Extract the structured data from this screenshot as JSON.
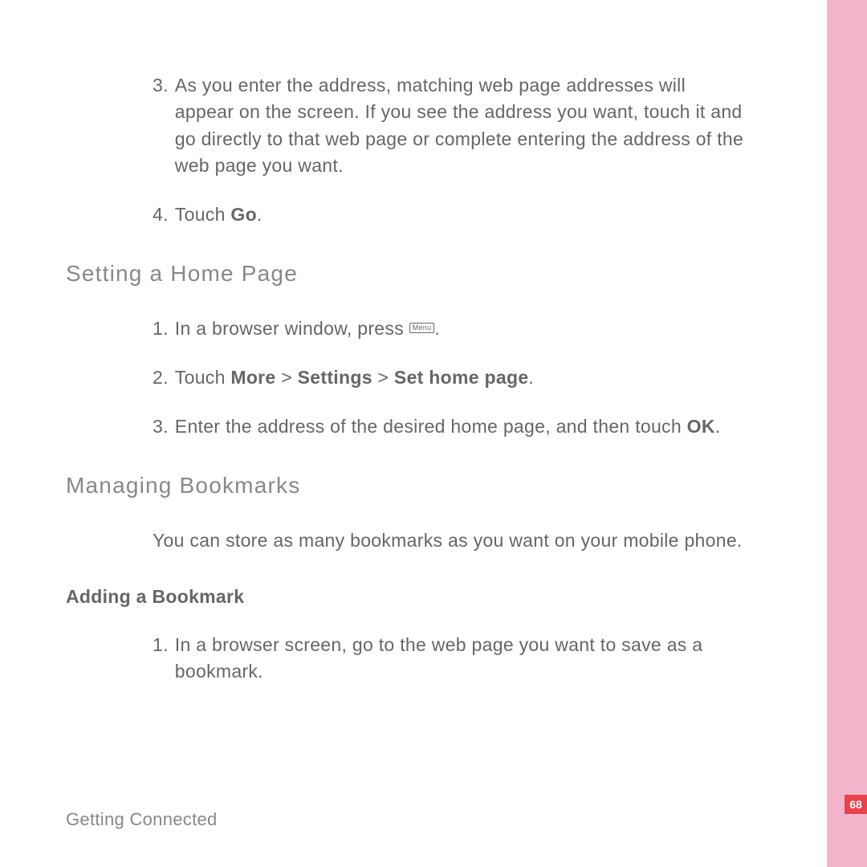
{
  "topSteps": {
    "step3": {
      "num": "3.",
      "text": "As you enter the address, matching web page addresses will appear on the screen. If you see the address you want, touch it and go directly to that web page or complete entering the address of the web page you want."
    },
    "step4": {
      "num": "4.",
      "prefix": "Touch ",
      "bold": "Go",
      "suffix": "."
    }
  },
  "heading1": "Setting a Home Page",
  "homeSteps": {
    "step1": {
      "num": "1.",
      "prefix": "In a browser window, press ",
      "key": "Menu",
      "suffix": "."
    },
    "step2": {
      "num": "2.",
      "prefix": "Touch ",
      "bold1": "More",
      "sep1": " > ",
      "bold2": "Settings",
      "sep2": " > ",
      "bold3": "Set home page",
      "suffix": "."
    },
    "step3": {
      "num": "3.",
      "prefix": "Enter the address of the desired home page, and then touch ",
      "bold": "OK",
      "suffix": "."
    }
  },
  "heading2": "Managing Bookmarks",
  "bookmarksIntro": "You can store as many bookmarks as you want on your mobile phone.",
  "heading3": "Adding a Bookmark",
  "addSteps": {
    "step1": {
      "num": "1.",
      "text": "In a browser screen, go to the web page you want to save as a bookmark."
    }
  },
  "footer": "Getting Connected",
  "pageNumber": "68"
}
